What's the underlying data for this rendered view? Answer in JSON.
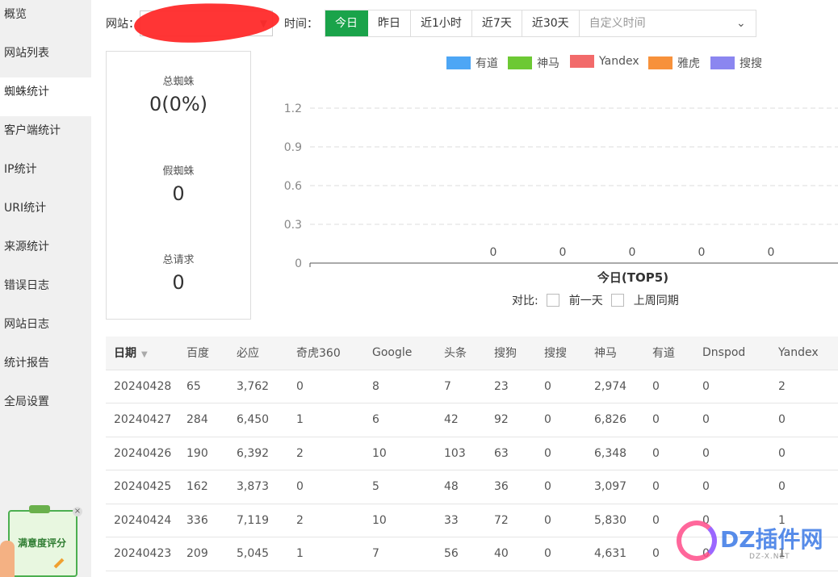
{
  "sidebar": {
    "items": [
      {
        "label": "概览"
      },
      {
        "label": "网站列表"
      },
      {
        "label": "蜘蛛统计"
      },
      {
        "label": "客户端统计"
      },
      {
        "label": "IP统计"
      },
      {
        "label": "URI统计"
      },
      {
        "label": "来源统计"
      },
      {
        "label": "错误日志"
      },
      {
        "label": "网站日志"
      },
      {
        "label": "统计报告"
      },
      {
        "label": "全局设置"
      }
    ],
    "active_index": 2,
    "satisfaction_label": "满意度评分"
  },
  "topbar": {
    "site_label": "网站：",
    "time_label": "时间：",
    "time_buttons": [
      "今日",
      "昨日",
      "近1小时",
      "近7天",
      "近30天"
    ],
    "active_time": "今日",
    "custom_time_placeholder": "自定义时间"
  },
  "stats": {
    "total_spider_label": "总蜘蛛",
    "total_spider_value": "0(0%)",
    "fake_spider_label": "假蜘蛛",
    "fake_spider_value": "0",
    "total_request_label": "总请求",
    "total_request_value": "0"
  },
  "chart_data": {
    "type": "bar",
    "title": "",
    "xlabel": "今日(TOP5)",
    "ylabel": "",
    "ylim": [
      0,
      1.2
    ],
    "yticks": [
      "0",
      "0.3",
      "0.6",
      "0.9",
      "1.2"
    ],
    "grid": true,
    "legend_position": "top",
    "series": [
      {
        "name": "有道",
        "color": "#4da6f5",
        "values": [
          0
        ]
      },
      {
        "name": "神马",
        "color": "#6dc934",
        "values": [
          0
        ]
      },
      {
        "name": "Yandex",
        "color": "#f26a6a",
        "values": [
          0
        ]
      },
      {
        "name": "雅虎",
        "color": "#f7913b",
        "values": [
          0
        ]
      },
      {
        "name": "搜搜",
        "color": "#8b86f0",
        "values": [
          0
        ]
      }
    ],
    "data_labels": [
      "0",
      "0",
      "0",
      "0",
      "0"
    ]
  },
  "compare": {
    "label": "对比:",
    "option1": "前一天",
    "option2": "上周同期"
  },
  "table": {
    "columns": [
      "日期",
      "百度",
      "必应",
      "奇虎360",
      "Google",
      "头条",
      "搜狗",
      "搜搜",
      "神马",
      "有道",
      "Dnspod",
      "Yandex"
    ],
    "rows": [
      [
        "20240428",
        "65",
        "3,762",
        "0",
        "8",
        "7",
        "23",
        "0",
        "2,974",
        "0",
        "0",
        "2"
      ],
      [
        "20240427",
        "284",
        "6,450",
        "1",
        "6",
        "42",
        "92",
        "0",
        "6,826",
        "0",
        "0",
        "0"
      ],
      [
        "20240426",
        "190",
        "6,392",
        "2",
        "10",
        "103",
        "63",
        "0",
        "6,348",
        "0",
        "0",
        "0"
      ],
      [
        "20240425",
        "162",
        "3,873",
        "0",
        "5",
        "48",
        "36",
        "0",
        "3,097",
        "0",
        "0",
        "0"
      ],
      [
        "20240424",
        "336",
        "7,119",
        "2",
        "10",
        "33",
        "72",
        "0",
        "5,830",
        "0",
        "0",
        "1"
      ],
      [
        "20240423",
        "209",
        "5,045",
        "1",
        "7",
        "56",
        "40",
        "0",
        "4,631",
        "0",
        "0",
        "1"
      ]
    ]
  },
  "watermark": {
    "text": "DZ插件网",
    "sub": "DZ-X.NET"
  }
}
